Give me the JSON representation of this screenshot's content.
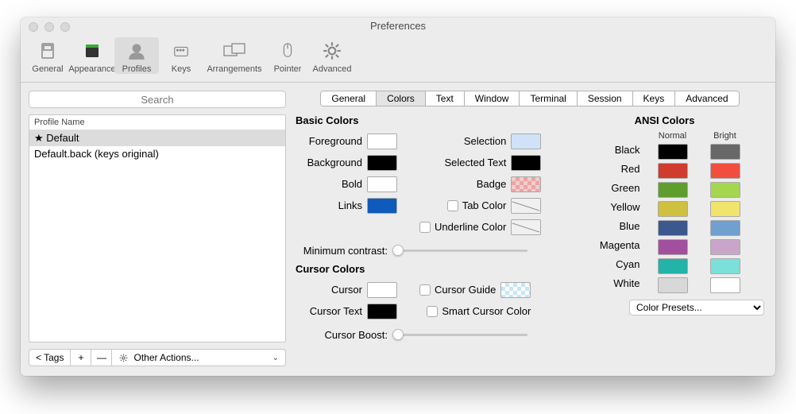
{
  "window_title": "Preferences",
  "toolbar": [
    {
      "id": "general",
      "label": "General"
    },
    {
      "id": "appearance",
      "label": "Appearance"
    },
    {
      "id": "profiles",
      "label": "Profiles"
    },
    {
      "id": "keys",
      "label": "Keys"
    },
    {
      "id": "arrangements",
      "label": "Arrangements"
    },
    {
      "id": "pointer",
      "label": "Pointer"
    },
    {
      "id": "advanced",
      "label": "Advanced"
    }
  ],
  "toolbar_active": "profiles",
  "search_placeholder": "Search",
  "profile_header": "Profile Name",
  "profiles": [
    {
      "label": "★ Default",
      "selected": true
    },
    {
      "label": "Default.back (keys original)",
      "selected": false
    }
  ],
  "tags_label": "< Tags",
  "plus": "+",
  "minus": "—",
  "other_actions": "Other Actions...",
  "tabs": [
    "General",
    "Colors",
    "Text",
    "Window",
    "Terminal",
    "Session",
    "Keys",
    "Advanced"
  ],
  "tab_active": "Colors",
  "basic_colors_hdr": "Basic Colors",
  "cursor_colors_hdr": "Cursor Colors",
  "ansi_colors_hdr": "ANSI Colors",
  "labels": {
    "foreground": "Foreground",
    "background": "Background",
    "bold": "Bold",
    "links": "Links",
    "selection": "Selection",
    "selected_text": "Selected Text",
    "badge": "Badge",
    "tab_color": "Tab Color",
    "underline_color": "Underline Color",
    "min_contrast": "Minimum contrast:",
    "cursor": "Cursor",
    "cursor_text": "Cursor Text",
    "cursor_guide": "Cursor Guide",
    "smart_cursor": "Smart Cursor Color",
    "cursor_boost": "Cursor Boost:",
    "normal": "Normal",
    "bright": "Bright"
  },
  "swatches": {
    "foreground": "#ffffff",
    "background": "#000000",
    "bold": "#ffffff",
    "links": "#0e5bbb",
    "selection": "#cfe2f8",
    "selected_text": "#000000",
    "cursor": "#ffffff",
    "cursor_text": "#000000"
  },
  "ansi": [
    {
      "name": "Black",
      "normal": "#000000",
      "bright": "#686868"
    },
    {
      "name": "Red",
      "normal": "#d13b2e",
      "bright": "#f14e3f"
    },
    {
      "name": "Green",
      "normal": "#5f9e2e",
      "bright": "#a4d64f"
    },
    {
      "name": "Yellow",
      "normal": "#cfc040",
      "bright": "#f1e46a"
    },
    {
      "name": "Blue",
      "normal": "#3b598f",
      "bright": "#6fa0cf"
    },
    {
      "name": "Magenta",
      "normal": "#a24f9e",
      "bright": "#c9a6c9"
    },
    {
      "name": "Cyan",
      "normal": "#24b3a8",
      "bright": "#7be0da"
    },
    {
      "name": "White",
      "normal": "#d8d8d8",
      "bright": "#ffffff"
    }
  ],
  "color_presets": "Color Presets..."
}
